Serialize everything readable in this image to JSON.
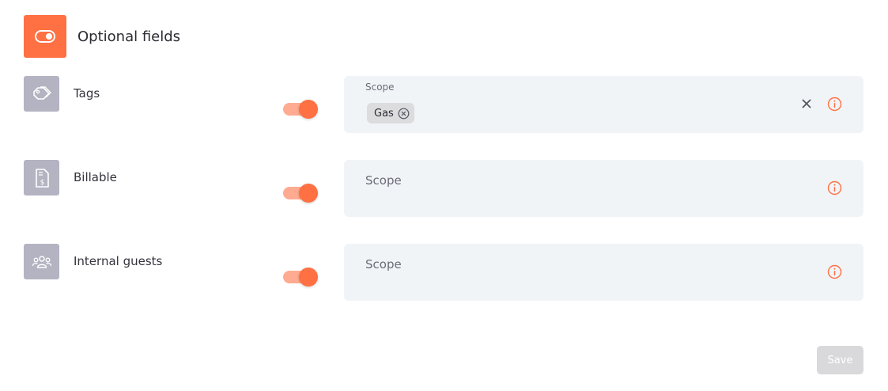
{
  "header": {
    "title": "Optional fields",
    "icon": "toggle-icon",
    "accent_color": "#ff7043"
  },
  "fields": [
    {
      "label": "Tags",
      "icon": "tag-icon",
      "enabled": true,
      "scope": {
        "label": "Scope",
        "chips": [
          "Gas"
        ],
        "has_clear": true,
        "info_icon": "info-icon"
      }
    },
    {
      "label": "Billable",
      "icon": "invoice-dollar-icon",
      "enabled": true,
      "scope": {
        "label": "Scope",
        "chips": [],
        "info_icon": "info-icon"
      }
    },
    {
      "label": "Internal guests",
      "icon": "group-icon",
      "enabled": true,
      "scope": {
        "label": "Scope",
        "chips": [],
        "info_icon": "info-icon"
      }
    }
  ],
  "footer": {
    "save_label": "Save",
    "save_disabled": true
  }
}
